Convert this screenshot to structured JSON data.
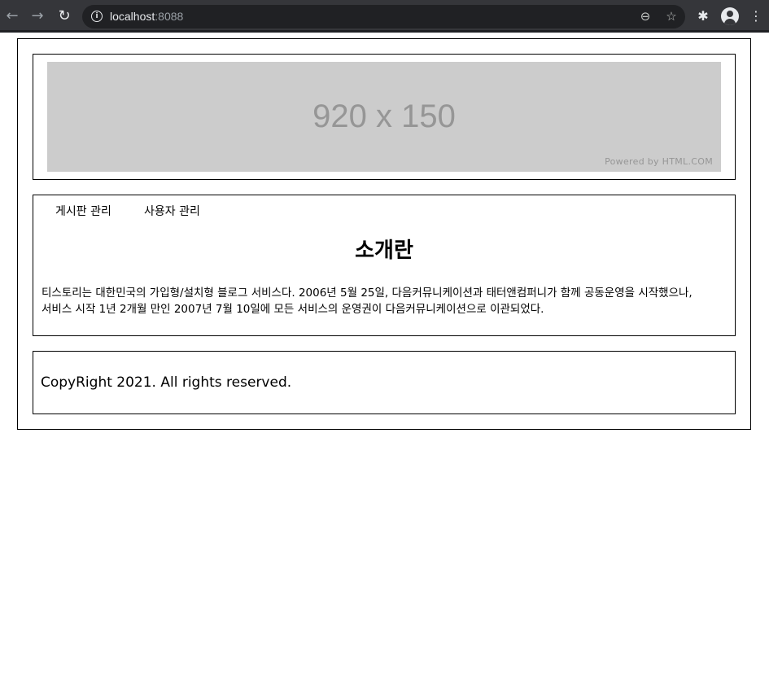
{
  "browser": {
    "url_host": "localhost",
    "url_port": ":8088",
    "back_icon": "←",
    "forward_icon": "→",
    "reload_icon": "↻",
    "info_icon": "i",
    "zoom_icon": "⊖",
    "bookmark_icon": "☆",
    "extensions_icon": "✱",
    "menu_icon": "⋮"
  },
  "header": {
    "banner_size": "920 x 150",
    "banner_credit": "Powered by HTML.COM"
  },
  "nav": {
    "items": [
      {
        "label": "게시판 관리"
      },
      {
        "label": "사용자 관리"
      }
    ]
  },
  "main": {
    "title": "소개란",
    "intro_line1": "티스토리는 대한민국의 가입형/설치형 블로그 서비스다. 2006년 5월 25일, 다음커뮤니케이션과 태터앤컴퍼니가 함께 공동운영을 시작했으나,",
    "intro_line2": "서비스 시작 1년 2개월 만인 2007년 7월 10일에 모든 서비스의 운영권이 다음커뮤니케이션으로 이관되었다."
  },
  "footer": {
    "text": "CopyRight 2021. All rights reserved."
  },
  "colors": {
    "chrome_bg": "#35363a",
    "omnibox_bg": "#202124",
    "banner_bg": "#cccccc",
    "banner_text": "#969696"
  }
}
